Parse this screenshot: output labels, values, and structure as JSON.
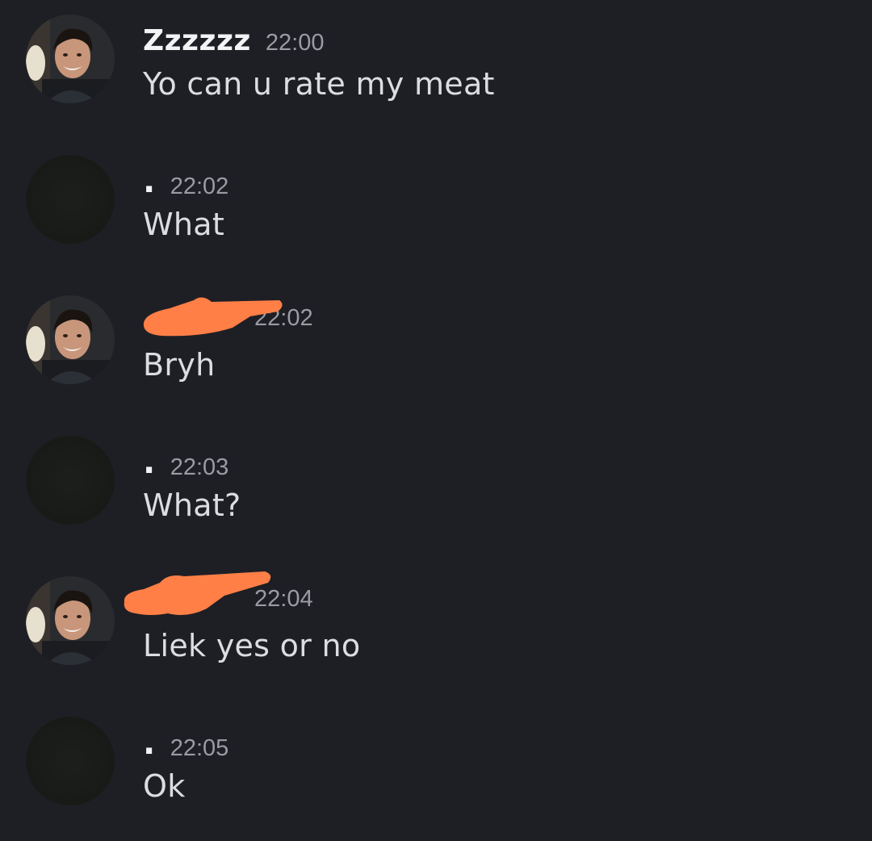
{
  "messages": [
    {
      "username": "Zzzzzz",
      "timestamp": "22:00",
      "content": "Yo can u rate my meat"
    },
    {
      "username": ".",
      "timestamp": "22:02",
      "content": "What"
    },
    {
      "username": "",
      "timestamp": "22:02",
      "content": "Bryh"
    },
    {
      "username": ".",
      "timestamp": "22:03",
      "content": "What?"
    },
    {
      "username": "",
      "timestamp": "22:04",
      "content": "Liek yes or no"
    },
    {
      "username": ".",
      "timestamp": "22:05",
      "content": "Ok"
    }
  ],
  "colors": {
    "background": "#1e1f24",
    "username": "#f2f3f5",
    "timestamp": "#9a9ba3",
    "message_text": "#dcdde1",
    "redaction": "#ff7f47"
  },
  "icons": {
    "photo_avatar": "person-photo-avatar",
    "dark_avatar": "dark-avatar",
    "redaction": "redaction-scribble"
  }
}
